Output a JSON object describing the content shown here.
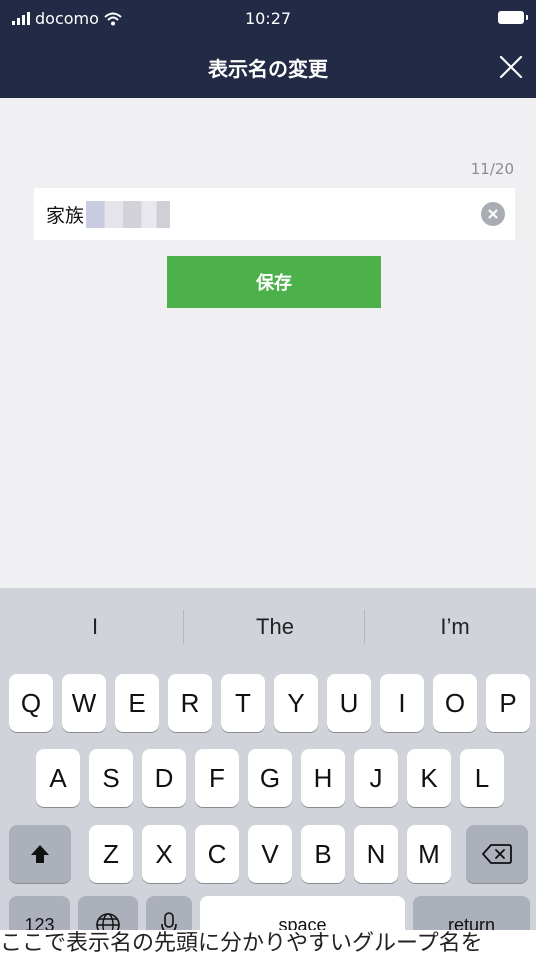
{
  "status": {
    "carrier": "docomo",
    "time": "10:27"
  },
  "header": {
    "title": "表示名の変更"
  },
  "editor": {
    "counter": "11/20",
    "value": "家族"
  },
  "save_label": "保存",
  "keyboard": {
    "suggestions": [
      "I",
      "The",
      "I’m"
    ],
    "row1": [
      "Q",
      "W",
      "E",
      "R",
      "T",
      "Y",
      "U",
      "I",
      "O",
      "P"
    ],
    "row2": [
      "A",
      "S",
      "D",
      "F",
      "G",
      "H",
      "J",
      "K",
      "L"
    ],
    "row3": [
      "Z",
      "X",
      "C",
      "V",
      "B",
      "N",
      "M"
    ],
    "numbers_label": "123",
    "space_label": "space",
    "return_label": "return"
  },
  "caption": "ここで表示名の先頭に分かりやすいグループ名を"
}
